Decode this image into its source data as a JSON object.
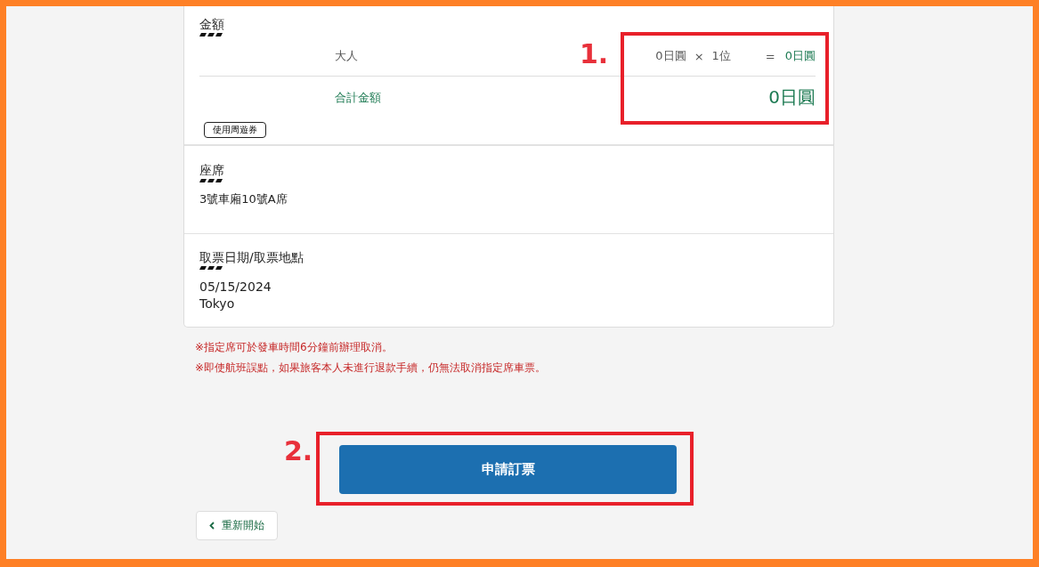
{
  "fare": {
    "title": "金額",
    "rows": [
      {
        "label": "大人",
        "unit_price": "0日圓",
        "times": "×",
        "count": "1位",
        "equals": "=",
        "subtotal": "0日圓"
      }
    ],
    "total_label": "合計金額",
    "total": "0日圓",
    "pass_button": "使用周遊券"
  },
  "seat": {
    "title": "座席",
    "value": "3號車廂10號A席"
  },
  "pickup": {
    "title": "取票日期/取票地點",
    "lines": [
      "05/15/2024",
      "Tokyo"
    ]
  },
  "notes": [
    "※指定席可於發車時間6分鐘前辦理取消。",
    "※即使航班誤點，如果旅客本人未進行退款手續，仍無法取消指定席車票。"
  ],
  "submit_button": "申請訂票",
  "restart_button": "重新開始",
  "annotations": [
    {
      "label": "1."
    },
    {
      "label": "2."
    }
  ]
}
